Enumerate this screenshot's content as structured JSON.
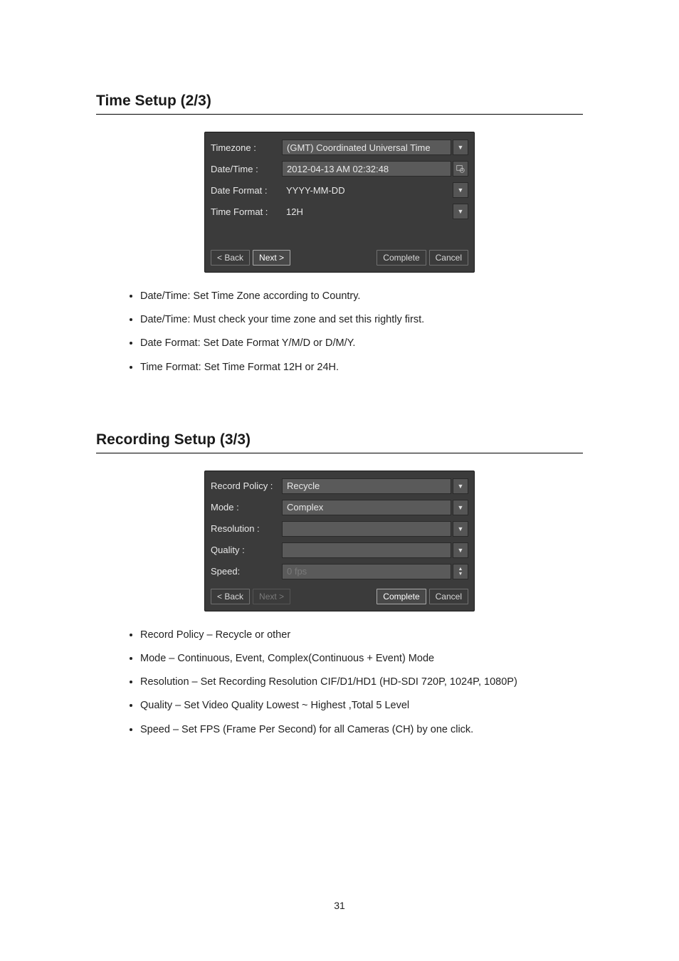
{
  "section1": {
    "title": "Time Setup (2/3)",
    "fields": {
      "timezone_label": "Timezone :",
      "timezone_value": "(GMT) Coordinated Universal Time",
      "datetime_label": "Date/Time :",
      "datetime_value": "2012-04-13 AM 02:32:48",
      "dateformat_label": "Date Format :",
      "dateformat_value": "YYYY-MM-DD",
      "timeformat_label": "Time Format :",
      "timeformat_value": "12H"
    },
    "buttons": {
      "back": "< Back",
      "next": "Next >",
      "complete": "Complete",
      "cancel": "Cancel"
    },
    "bullets": [
      "Date/Time: Set Time Zone according to Country.",
      "Date/Time: Must check your time zone and set this rightly first.",
      "Date Format: Set Date Format Y/M/D or D/M/Y.",
      "Time Format: Set Time Format 12H or 24H."
    ]
  },
  "section2": {
    "title": "Recording Setup (3/3)",
    "fields": {
      "policy_label": "Record Policy :",
      "policy_value": "Recycle",
      "mode_label": "Mode :",
      "mode_value": "Complex",
      "resolution_label": "Resolution :",
      "resolution_value": "",
      "quality_label": "Quality :",
      "quality_value": "",
      "speed_label": "Speed:",
      "speed_value": "0 fps"
    },
    "buttons": {
      "back": "< Back",
      "next": "Next >",
      "complete": "Complete",
      "cancel": "Cancel"
    },
    "bullets": [
      "Record Policy – Recycle or other",
      "Mode – Continuous, Event, Complex(Continuous + Event) Mode",
      "Resolution – Set Recording Resolution CIF/D1/HD1 (HD-SDI 720P, 1024P, 1080P)",
      "Quality – Set Video Quality Lowest ~ Highest ,Total 5 Level",
      "Speed – Set FPS (Frame Per Second) for all Cameras (CH) by one click."
    ]
  },
  "page_number": "31"
}
